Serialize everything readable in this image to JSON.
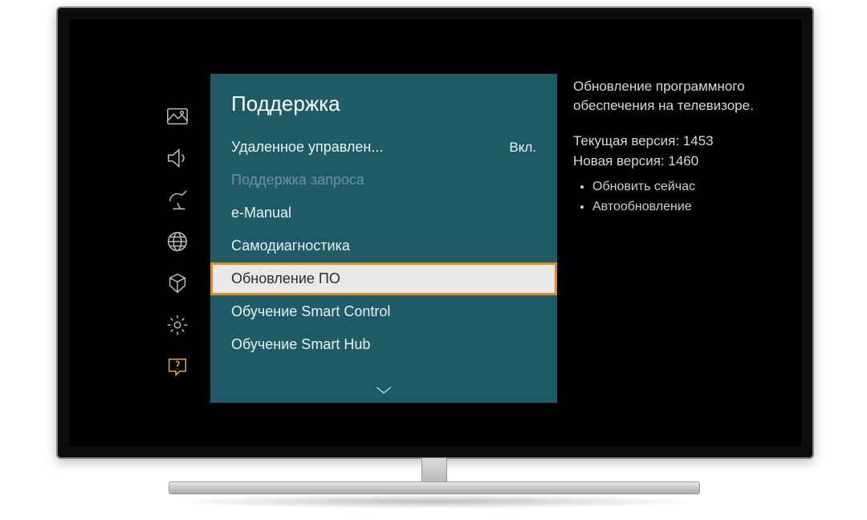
{
  "sidebar": {
    "items": [
      {
        "name": "picture-icon"
      },
      {
        "name": "sound-icon"
      },
      {
        "name": "broadcast-icon"
      },
      {
        "name": "network-icon"
      },
      {
        "name": "system-icon"
      },
      {
        "name": "settings-icon"
      },
      {
        "name": "support-icon",
        "active": true
      }
    ]
  },
  "menu": {
    "title": "Поддержка",
    "items": [
      {
        "label": "Удаленное управлен...",
        "value": "Вкл."
      },
      {
        "label": "Поддержка запроса",
        "disabled": true
      },
      {
        "label": "e-Manual"
      },
      {
        "label": "Самодиагностика"
      },
      {
        "label": "Обновление ПО",
        "selected": true
      },
      {
        "label": "Обучение Smart Control"
      },
      {
        "label": "Обучение Smart Hub"
      }
    ]
  },
  "info": {
    "description": "Обновление программного обеспечения на телевизоре.",
    "current_label": "Текущая версия:",
    "current_value": "1453",
    "new_label": "Новая версия:",
    "new_value": "1460",
    "bullets": [
      "Обновить сейчас",
      "Автообновление"
    ]
  }
}
